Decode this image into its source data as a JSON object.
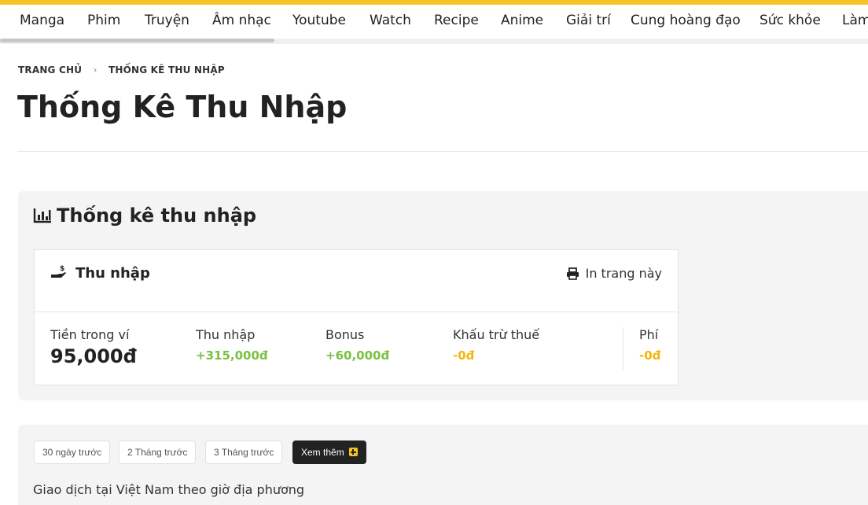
{
  "nav": {
    "items": [
      "Manga",
      "Phim",
      "Truyện",
      "Âm nhạc",
      "Youtube",
      "Watch",
      "Recipe",
      "Anime",
      "Giải trí",
      "Cung hoàng đạo",
      "Sức khỏe",
      "Làm"
    ]
  },
  "breadcrumb": {
    "home": "TRANG CHỦ",
    "current": "THỐNG KÊ THU NHẬP"
  },
  "page": {
    "title": "Thống Kê Thu Nhập"
  },
  "stats": {
    "heading": "Thống kê thu nhập",
    "card_title": "Thu nhập",
    "print_label": "In trang này",
    "items": [
      {
        "label": "Tiền trong ví",
        "value": "95,000đ"
      },
      {
        "label": "Thu nhập",
        "value": "+315,000đ"
      },
      {
        "label": "Bonus",
        "value": "+60,000đ"
      },
      {
        "label": "Khấu trừ thuế",
        "value": "-0đ"
      },
      {
        "label": "Phí",
        "value": "-0đ"
      }
    ]
  },
  "transactions": {
    "filters": [
      "30 ngày trước",
      "2 Tháng trước",
      "3 Tháng trước"
    ],
    "more_label": "Xem thêm",
    "note": "Giao dịch tại Việt Nam theo giờ địa phương"
  },
  "colors": {
    "accent": "#f6c324",
    "positive": "#7ac142",
    "deduction": "#f5b50a",
    "dark_button": "#222222"
  }
}
